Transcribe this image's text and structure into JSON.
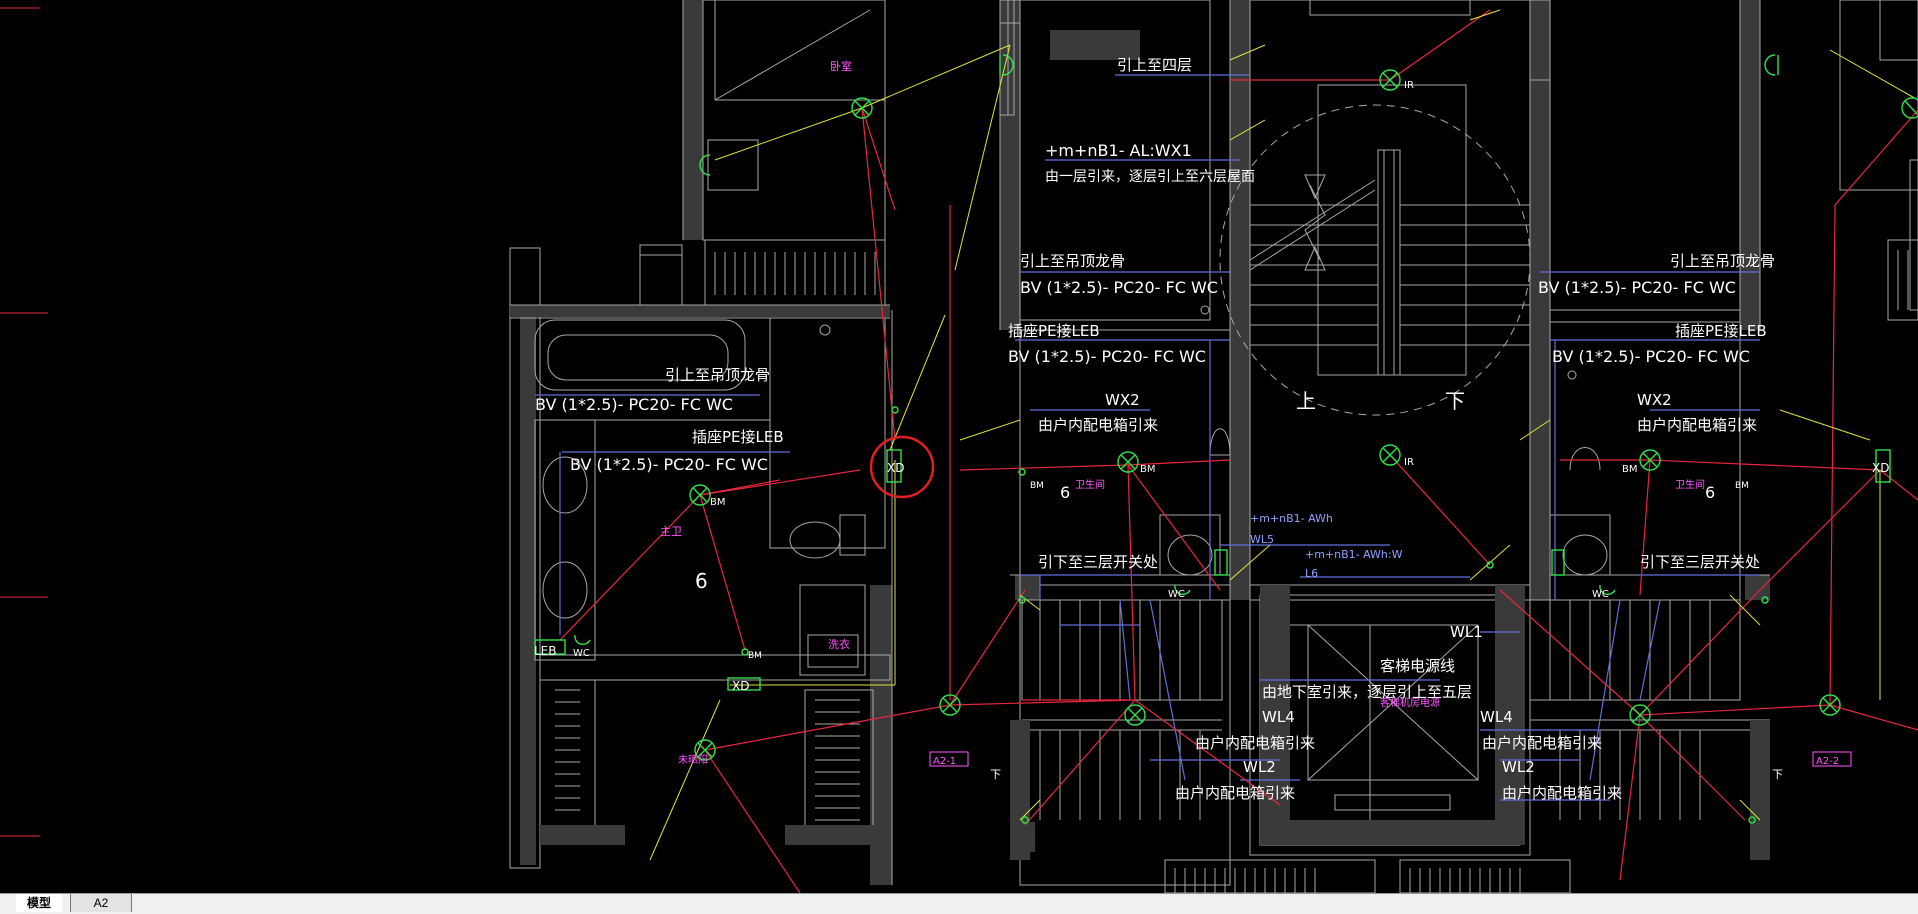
{
  "colors": {
    "background": "#000000",
    "wall": "#a8a8a8",
    "blue_line": "#5f6fd9",
    "red_wire": "#e8273c",
    "yellow_wire": "#e4e23a",
    "green_symbol": "#2ee24a",
    "pink_text": "#ff55ff",
    "white_text": "#ffffff",
    "markup_circle": "#e02020"
  },
  "drawing": {
    "labels": {
      "bedroom": "卧室",
      "up_to_4f": "引上至四层",
      "wx1_code": "+m+nB1- AL:WX1",
      "wx1_desc": "由一层引来，逐层引上至六层屋面",
      "up_ceiling_left": "引上至吊顶龙骨",
      "bv_left": "BV (1*2.5)- PC20- FC WC",
      "socket_pe_left": "插座PE接LEB",
      "bv_left2": "BV (1*2.5)- PC20- FC WC",
      "up_ceiling_mid": "引上至吊顶龙骨",
      "bv_mid": "BV (1*2.5)- PC20- FC WC",
      "socket_pe_mid": "插座PE接LEB",
      "bv_mid2": "BV (1*2.5)- PC20- FC WC",
      "wx2_left": "WX2",
      "from_box_left": "由户内配电箱引来",
      "up_ceiling_right": "引上至吊顶龙骨",
      "bv_right": "BV (1*2.5)- PC20- FC WC",
      "socket_pe_right": "插座PE接LEB",
      "bv_right2": "BV (1*2.5)- PC20- FC WC",
      "wx2_right": "WX2",
      "from_box_right": "由户内配电箱引来",
      "up_char": "上",
      "down_char": "下",
      "awh_code": "+m+nB1- AWh",
      "wl5": "WL5",
      "awhw_code": "+m+nB1- AWh:W",
      "l6": "L6",
      "down_3f_left": "引下至三层开关处",
      "down_3f_right": "引下至三层开关处",
      "wl1": "WL1",
      "elevator_power": "客梯电源线",
      "basement_desc": "由地下室引来，逐层引上至五层",
      "elevator_room": "客梯机房电源",
      "wl4_left": "WL4",
      "from_box_wl4_left": "由户内配电箱引来",
      "wl2_left": "WL2",
      "from_box_wl2_left": "由户内配电箱引来",
      "wl4_right": "WL4",
      "from_box_wl4_right": "由户内配电箱引来",
      "wl2_right": "WL2",
      "from_box_wl2_right": "由户内配电箱引来",
      "master_bath": "主卫",
      "bath_mid": "卫生间",
      "bath_right": "卫生间",
      "laundry": "洗衣",
      "balcony": "未晒阳",
      "bm": "BM",
      "wc": "WC",
      "ir": "IR",
      "xd": "XD",
      "leb": "LEB",
      "num6": "6",
      "a21": "A2-1",
      "a22": "A2-2",
      "down_small": "下"
    }
  },
  "tabs": {
    "model": "模型",
    "layout": "A2"
  }
}
